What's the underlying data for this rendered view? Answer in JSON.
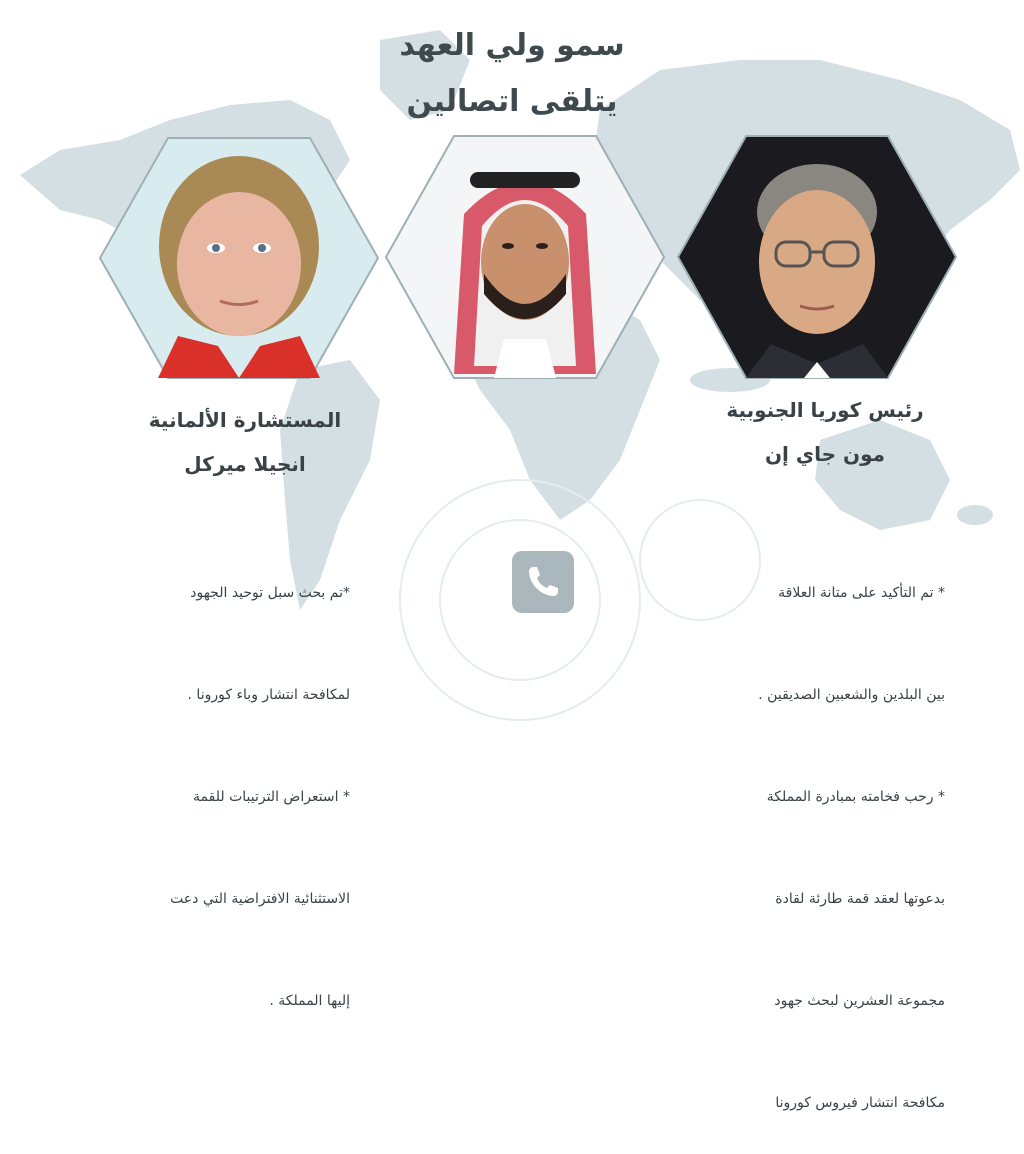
{
  "header": {
    "line1": "سمو ولي العهد",
    "line2": "يتلقى اتصالين"
  },
  "left_person": {
    "title": "المستشارة الألمانية",
    "name": "انجيلا ميركل",
    "bullets": [
      "*تم بحث سبل توحيد الجهود",
      "لمكافحة انتشار وباء كورونا .",
      "* استعراض الترتيبات للقمة",
      "الاستثنائية الافتراضية التي دعت",
      "إليها المملكة ."
    ]
  },
  "center_person": {
    "portrait": "crown-prince-portrait"
  },
  "right_person": {
    "title": "رئيس كوريا الجنوبية",
    "name": "مون جاي إن",
    "bullets": [
      "* تم التأكيد على متانة العلاقة",
      "بين البلدين والشعبين الصديقين .",
      "* رحب فخامته بمبادرة المملكة",
      "بدعوتها لعقد قمة طارئة لقادة",
      "مجموعة العشرين لبحث جهود",
      "مكافحة انتشار فيروس كورونا"
    ]
  },
  "colors": {
    "map": "#d4dfe3",
    "title_text": "#3f4a4f",
    "body_text": "#3a4246",
    "hex_border": "#9fb0b5",
    "phone_bg": "#aab7bc"
  },
  "icons": {
    "phone": "phone-icon",
    "map": "world-map-icon",
    "virus": "virus-icon"
  }
}
